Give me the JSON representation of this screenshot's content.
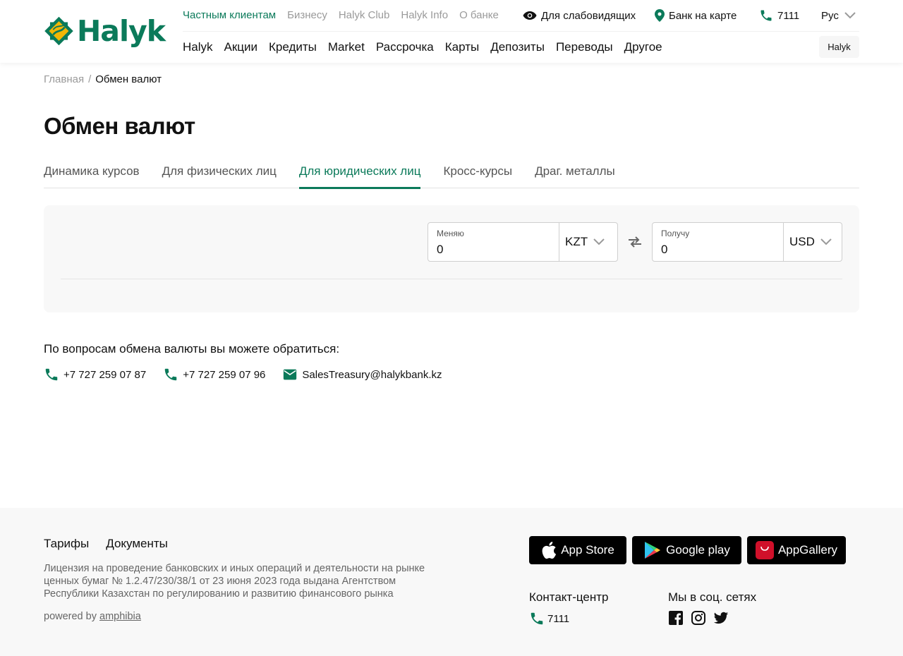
{
  "header": {
    "logo_text": "Halyk",
    "top_nav": [
      {
        "label": "Частным клиентам",
        "active": true
      },
      {
        "label": "Бизнесу",
        "active": false
      },
      {
        "label": "Halyk Club",
        "active": false
      },
      {
        "label": "Halyk Info",
        "active": false
      },
      {
        "label": "О банке",
        "active": false
      }
    ],
    "accessibility_label": "Для слабовидящих",
    "map_label": "Банк на карте",
    "phone": "7111",
    "language": "Рус",
    "main_nav": [
      "Halyk",
      "Акции",
      "Кредиты",
      "Market",
      "Рассрочка",
      "Карты",
      "Депозиты",
      "Переводы",
      "Другое"
    ],
    "halyk_button": "Halyk"
  },
  "breadcrumb": {
    "home": "Главная",
    "separator": "/",
    "current": "Обмен валют"
  },
  "page_title": "Обмен валют",
  "tabs": [
    {
      "label": "Динамика курсов",
      "active": false
    },
    {
      "label": "Для физических лиц",
      "active": false
    },
    {
      "label": "Для юридических лиц",
      "active": true
    },
    {
      "label": "Кросс-курсы",
      "active": false
    },
    {
      "label": "Драг. металлы",
      "active": false
    }
  ],
  "converter": {
    "give": {
      "label": "Меняю",
      "value": "0",
      "currency": "KZT"
    },
    "get": {
      "label": "Получу",
      "value": "0",
      "currency": "USD"
    }
  },
  "contacts": {
    "title": "По вопросам обмена валюты вы можете обратиться:",
    "phone1": "+7 727 259 07 87",
    "phone2": "+7 727 259 07 96",
    "email": "SalesTreasury@halykbank.kz"
  },
  "footer": {
    "links": [
      "Тарифы",
      "Документы"
    ],
    "license": "Лицензия на проведение банковских и иных операций и деятельности на рынке ценных бумаг № 1.2.47/230/38/1 от 23 июня 2023 года выдана Агентством Республики Казахстан по регулированию и развитию финансового рынка",
    "powered_prefix": "powered by",
    "powered_link": "amphibia",
    "stores": {
      "app_store": "App Store",
      "google_play": "Google play",
      "app_gallery": "AppGallery"
    },
    "contact_center_title": "Контакт-центр",
    "contact_center_phone": "7111",
    "social_title": "Мы в соц. сетях",
    "social_icons": [
      "facebook-icon",
      "instagram-icon",
      "twitter-icon"
    ]
  },
  "colors": {
    "brand_green": "#0b7a5a",
    "logo_yellow": "#f2b705"
  }
}
